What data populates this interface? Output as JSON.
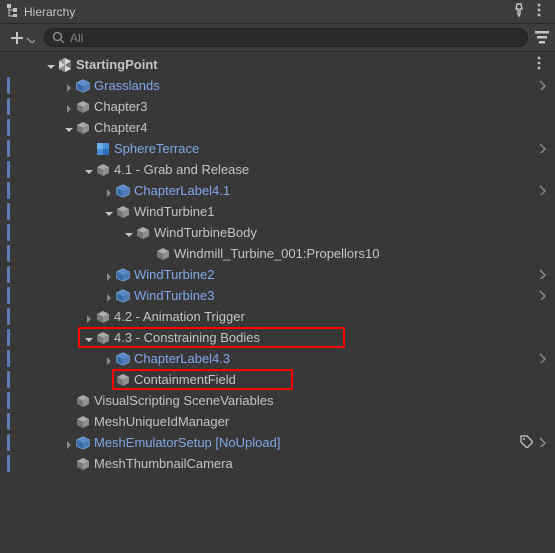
{
  "panel": {
    "title": "Hierarchy"
  },
  "search": {
    "placeholder": "All"
  },
  "rootName": "StartingPoint",
  "nodes": {
    "grasslands": "Grasslands",
    "chapter3": "Chapter3",
    "chapter4": "Chapter4",
    "sphereTerrace": "SphereTerrace",
    "sec41": "4.1 - Grab and Release",
    "chapterLabel41": "ChapterLabel4.1",
    "windTurbine1": "WindTurbine1",
    "windTurbineBody": "WindTurbineBody",
    "propellors": "Windmill_Turbine_001:Propellors10",
    "windTurbine2": "WindTurbine2",
    "windTurbine3": "WindTurbine3",
    "sec42": "4.2 - Animation Trigger",
    "sec43": "4.3 - Constraining Bodies",
    "chapterLabel43": "ChapterLabel4.3",
    "containmentField": "ContainmentField",
    "visualScripting": "VisualScripting SceneVariables",
    "meshUniqueId": "MeshUniqueIdManager",
    "meshEmulator": "MeshEmulatorSetup [NoUpload]",
    "meshThumbnail": "MeshThumbnailCamera"
  }
}
